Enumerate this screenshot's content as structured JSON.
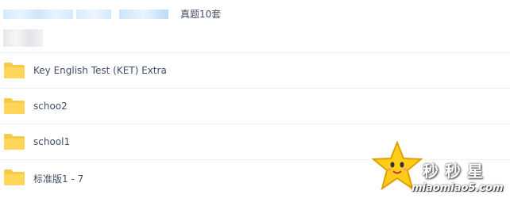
{
  "breadcrumb": {
    "current": "真题10套"
  },
  "files": [
    {
      "name": "Key English Test (KET) Extra",
      "icon": "folder-icon"
    },
    {
      "name": "schoo2",
      "icon": "folder-icon"
    },
    {
      "name": "school1",
      "icon": "folder-icon"
    },
    {
      "name": "标准版1 - 7",
      "icon": "folder-icon"
    }
  ],
  "watermark": {
    "title": "秒秒星",
    "url": "miaomiao5.com"
  },
  "colors": {
    "folder": "#ffd659",
    "folder_tab": "#f7c948",
    "text": "#424e67",
    "divider": "#f1f2f4"
  }
}
